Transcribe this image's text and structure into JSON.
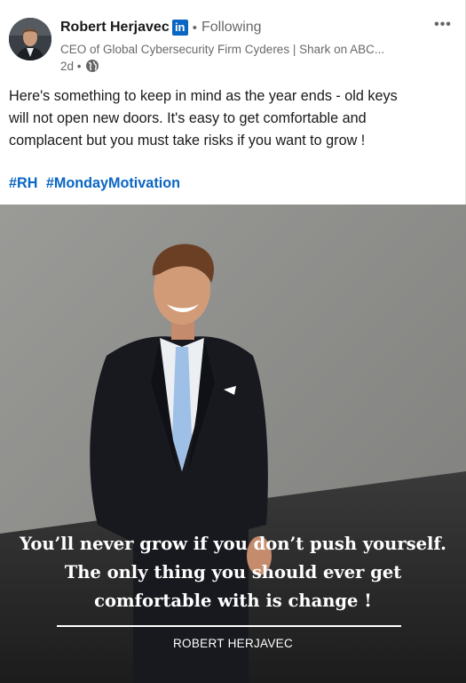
{
  "post": {
    "author": {
      "name": "Robert Herjavec",
      "badge": "in",
      "connection": "Following",
      "headline": "CEO of Global Cybersecurity Firm Cyderes | Shark on ABC...",
      "time": "2d",
      "visibility_icon": "globe-icon"
    },
    "more_icon": "•••",
    "text_lines": [
      "Here's something to keep in mind as the year ends - old keys",
      "will not open new doors. It's easy to get comfortable and",
      "complacent but you must take risks if you want to grow !"
    ],
    "hashtags": [
      "#RH",
      "#MondayMotivation"
    ],
    "image": {
      "quote_lines": [
        "You’ll never grow if you don’t push yourself.",
        "The only thing you should ever get",
        "comfortable with is change !"
      ],
      "attribution": "ROBERT HERJAVEC"
    }
  },
  "colors": {
    "link": "#0a66c2",
    "background": "#ffffff",
    "muted_text": "#666666"
  }
}
